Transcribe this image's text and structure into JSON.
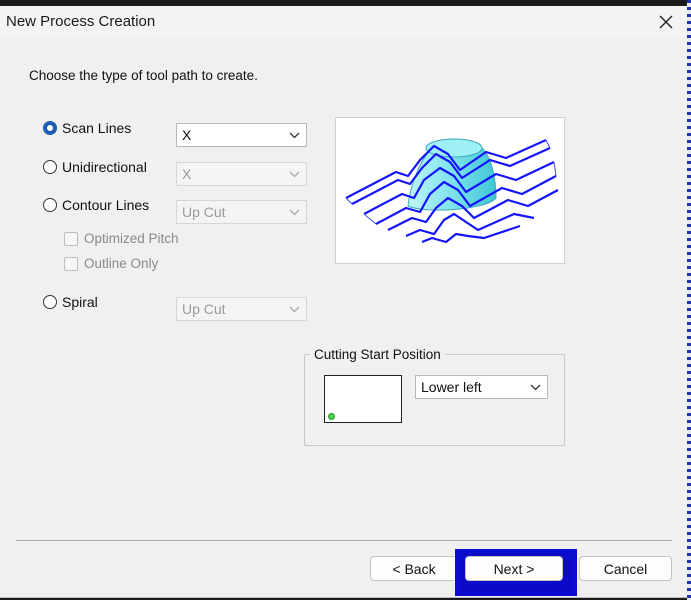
{
  "window": {
    "title": "New Process Creation",
    "close_icon": "close-icon"
  },
  "prompt": "Choose the type of tool path to create.",
  "path_types": [
    {
      "label": "Scan Lines",
      "checked": true,
      "combo_value": "X",
      "combo_enabled": true
    },
    {
      "label": "Unidirectional",
      "checked": false,
      "combo_value": "X",
      "combo_enabled": false
    },
    {
      "label": "Contour Lines",
      "checked": false,
      "combo_value": "Up Cut",
      "combo_enabled": false
    },
    {
      "label": "Spiral",
      "checked": false,
      "combo_value": "Up Cut",
      "combo_enabled": false
    }
  ],
  "contour_options": [
    {
      "label": "Optimized Pitch",
      "checked": false,
      "enabled": false
    },
    {
      "label": "Outline Only",
      "checked": false,
      "enabled": false
    }
  ],
  "cutting_start": {
    "group_label": "Cutting Start Position",
    "selected": "Lower left"
  },
  "buttons": {
    "back": "< Back",
    "next": "Next >",
    "cancel": "Cancel"
  },
  "colors": {
    "accent": "#1a5fb4",
    "toolpath_blue": "#1414ff",
    "dome_cyan": "#7fe3ec",
    "highlight_blue": "#0c0cd0",
    "start_dot": "#4fd14f"
  }
}
